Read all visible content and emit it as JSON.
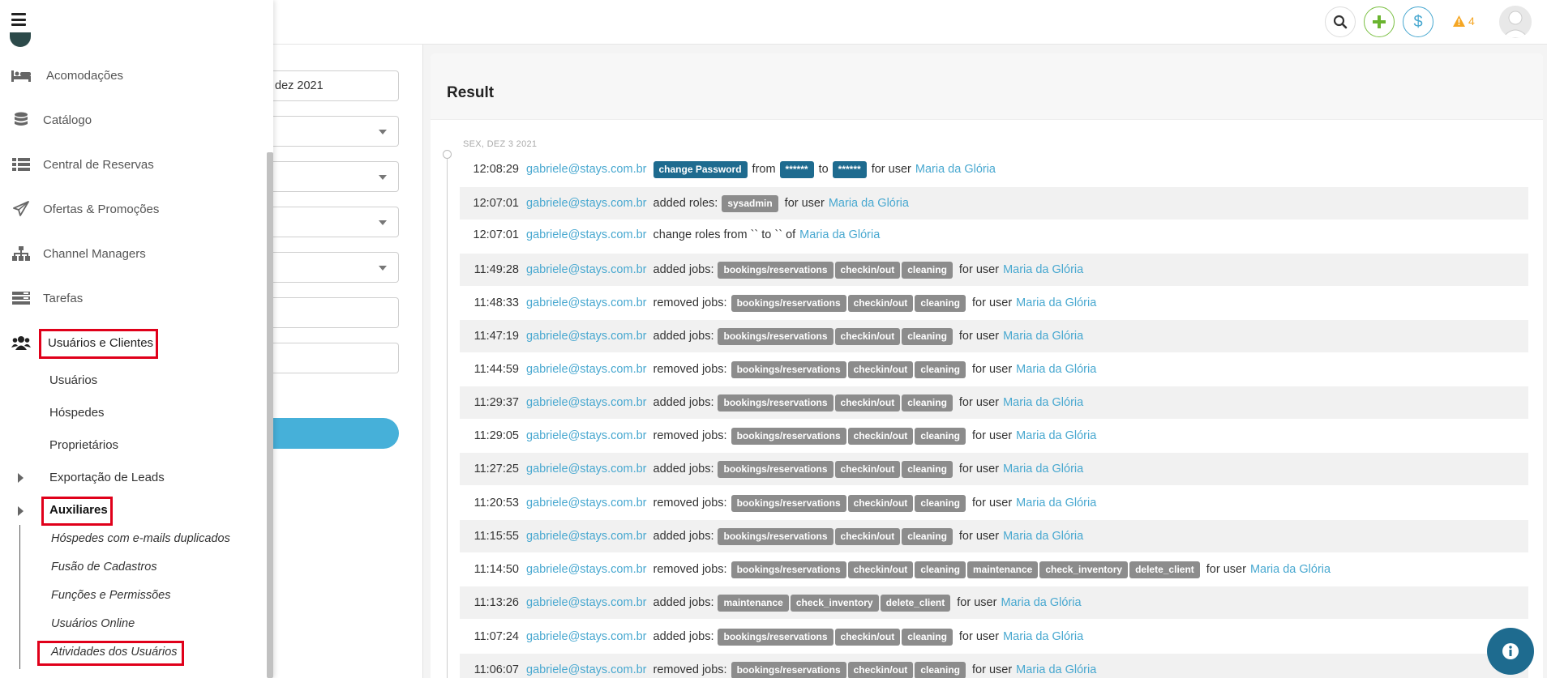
{
  "topbar": {
    "alert_count": "4"
  },
  "sidebar": {
    "items": [
      {
        "label": "Acomodações",
        "icon": "bed-icon"
      },
      {
        "label": "Catálogo",
        "icon": "database-icon"
      },
      {
        "label": "Central de Reservas",
        "icon": "list-icon"
      },
      {
        "label": "Ofertas & Promoções",
        "icon": "paper-plane-icon"
      },
      {
        "label": "Channel Managers",
        "icon": "sitemap-icon"
      },
      {
        "label": "Tarefas",
        "icon": "tasks-icon"
      },
      {
        "label": "Usuários e Clientes",
        "icon": "users-icon"
      }
    ],
    "subitems": [
      "Usuários",
      "Hóspedes",
      "Proprietários",
      "Exportação de Leads",
      "Auxiliares"
    ],
    "auxiliares": [
      "Hóspedes com e-mails duplicados",
      "Fusão de Cadastros",
      "Funções e Permissões",
      "Usuários Online",
      "Atividades dos Usuários"
    ]
  },
  "form": {
    "date_value": "dez 2021"
  },
  "result": {
    "title": "Result",
    "date_label": "SEX, DEZ 3 2021",
    "email": "gabriele@stays.com.br",
    "user": "Maria da Glória",
    "rows": [
      {
        "time": "12:08:29",
        "action": "change_password",
        "alt": false
      },
      {
        "time": "12:07:01",
        "action": "added roles:",
        "tags": [
          "sysadmin"
        ],
        "suffix": "for user",
        "alt": true
      },
      {
        "time": "12:07:01",
        "action": "change roles from `` to `` of",
        "tags": [],
        "suffix": "",
        "alt": false
      },
      {
        "time": "11:49:28",
        "action": "added jobs:",
        "tags": [
          "bookings/reservations",
          "checkin/out",
          "cleaning"
        ],
        "suffix": "for user",
        "alt": true
      },
      {
        "time": "11:48:33",
        "action": "removed jobs:",
        "tags": [
          "bookings/reservations",
          "checkin/out",
          "cleaning"
        ],
        "suffix": "for user",
        "alt": false
      },
      {
        "time": "11:47:19",
        "action": "added jobs:",
        "tags": [
          "bookings/reservations",
          "checkin/out",
          "cleaning"
        ],
        "suffix": "for user",
        "alt": true
      },
      {
        "time": "11:44:59",
        "action": "removed jobs:",
        "tags": [
          "bookings/reservations",
          "checkin/out",
          "cleaning"
        ],
        "suffix": "for user",
        "alt": false
      },
      {
        "time": "11:29:37",
        "action": "added jobs:",
        "tags": [
          "bookings/reservations",
          "checkin/out",
          "cleaning"
        ],
        "suffix": "for user",
        "alt": true
      },
      {
        "time": "11:29:05",
        "action": "removed jobs:",
        "tags": [
          "bookings/reservations",
          "checkin/out",
          "cleaning"
        ],
        "suffix": "for user",
        "alt": false
      },
      {
        "time": "11:27:25",
        "action": "added jobs:",
        "tags": [
          "bookings/reservations",
          "checkin/out",
          "cleaning"
        ],
        "suffix": "for user",
        "alt": true
      },
      {
        "time": "11:20:53",
        "action": "removed jobs:",
        "tags": [
          "bookings/reservations",
          "checkin/out",
          "cleaning"
        ],
        "suffix": "for user",
        "alt": false
      },
      {
        "time": "11:15:55",
        "action": "added jobs:",
        "tags": [
          "bookings/reservations",
          "checkin/out",
          "cleaning"
        ],
        "suffix": "for user",
        "alt": true
      },
      {
        "time": "11:14:50",
        "action": "removed jobs:",
        "tags": [
          "bookings/reservations",
          "checkin/out",
          "cleaning",
          "maintenance",
          "check_inventory",
          "delete_client"
        ],
        "suffix": "for user",
        "alt": false
      },
      {
        "time": "11:13:26",
        "action": "added jobs:",
        "tags": [
          "maintenance",
          "check_inventory",
          "delete_client"
        ],
        "suffix": "for user",
        "alt": true
      },
      {
        "time": "11:07:24",
        "action": "added jobs:",
        "tags": [
          "bookings/reservations",
          "checkin/out",
          "cleaning"
        ],
        "suffix": "for user",
        "alt": false
      },
      {
        "time": "11:06:07",
        "action": "removed jobs:",
        "tags": [
          "bookings/reservations",
          "checkin/out",
          "cleaning"
        ],
        "suffix": "for user",
        "alt": true
      }
    ],
    "pw_row": {
      "tag1": "change Password",
      "from": "from",
      "tag2": "******",
      "to": "to",
      "tag3": "******",
      "suffix": "for user"
    }
  },
  "colors": {
    "accent": "#48a8d0",
    "highlight": "#e0001a",
    "tag": "#8c8c8c",
    "tag_dark": "#1e6b8f"
  }
}
